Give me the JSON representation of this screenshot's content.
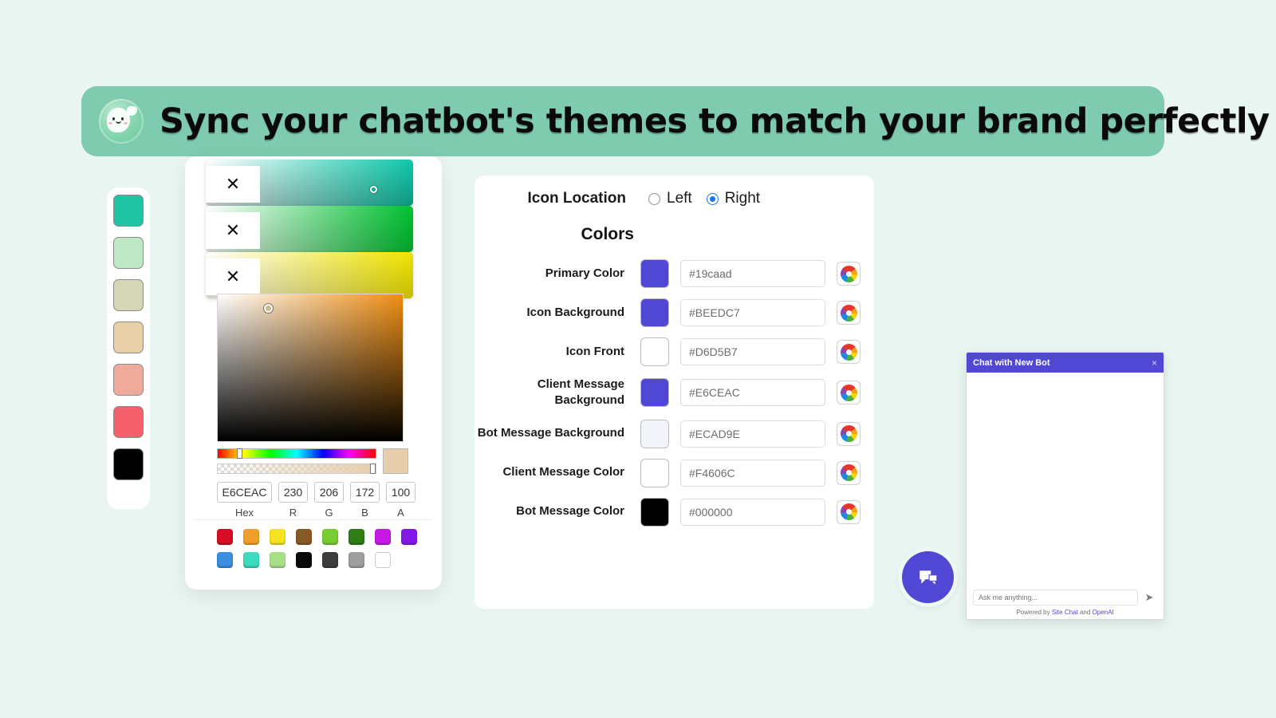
{
  "banner": {
    "title": "Sync your chatbot's themes to match your brand perfectly",
    "background": "#7ecbb0",
    "logo_icon": "chat-mascot-icon"
  },
  "page": {
    "background": "#e8f5f0"
  },
  "swatch_rail": {
    "swatches": [
      {
        "name": "teal",
        "color": "#1fc4a4"
      },
      {
        "name": "light-mint",
        "color": "#bfe9c6"
      },
      {
        "name": "sage-beige",
        "color": "#d5d6b6"
      },
      {
        "name": "tan",
        "color": "#e9cfa8"
      },
      {
        "name": "salmon",
        "color": "#eeab9b"
      },
      {
        "name": "coral-red",
        "color": "#f4606c"
      },
      {
        "name": "black",
        "color": "#000000"
      }
    ]
  },
  "color_picker": {
    "close_label": "✕",
    "mini_pickers": [
      {
        "name": "teal-gradient",
        "from": "#ffffff",
        "to": "#0fc8aa"
      },
      {
        "name": "green-gradient",
        "from": "#ffffff",
        "to": "#00c230"
      },
      {
        "name": "yellow-gradient",
        "from": "#ffffff",
        "to": "#f0e400"
      }
    ],
    "saturation": {
      "hue_color": "#ef8e12"
    },
    "preview": "#e6ceac",
    "fields": [
      {
        "label": "Hex",
        "value": "E6CEAC",
        "kind": "hex"
      },
      {
        "label": "R",
        "value": "230",
        "kind": "num"
      },
      {
        "label": "G",
        "value": "206",
        "kind": "num"
      },
      {
        "label": "B",
        "value": "172",
        "kind": "num"
      },
      {
        "label": "A",
        "value": "100",
        "kind": "num"
      }
    ],
    "palette": [
      "#d80d23",
      "#f0a02a",
      "#f5e320",
      "#8a5a26",
      "#78cc32",
      "#2e7d15",
      "#c619e6",
      "#8318e8",
      "#3b8ee0",
      "#3cdcc0",
      "#a8e08a",
      "#0a0a0a",
      "#3d3d3d",
      "#9e9e9e",
      "#ffffff"
    ]
  },
  "settings": {
    "icon_location": {
      "label": "Icon Location",
      "options": [
        {
          "label": "Left",
          "selected": false
        },
        {
          "label": "Right",
          "selected": true
        }
      ]
    },
    "colors_heading": "Colors",
    "accent": "#5147d5",
    "rows": [
      {
        "label": "Primary Color",
        "value": "#19caad",
        "chip": "#5147d5"
      },
      {
        "label": "Icon Background",
        "value": "#BEEDC7",
        "chip": "#5147d5"
      },
      {
        "label": "Icon Front",
        "value": "#D6D5B7",
        "chip": "#ffffff"
      },
      {
        "label": "Client Message Background",
        "value": "#E6CEAC",
        "chip": "#5147d5"
      },
      {
        "label": "Bot Message Background",
        "value": "#ECAD9E",
        "chip": "#f1f4f9"
      },
      {
        "label": "Client Message Color",
        "value": "#F4606C",
        "chip": "#ffffff"
      },
      {
        "label": "Bot Message Color",
        "value": "#000000",
        "chip": "#000000"
      }
    ]
  },
  "chat_widget": {
    "title": "Chat with New Bot",
    "close_label": "×",
    "input_placeholder": "Ask me anything...",
    "send_icon": "send-icon",
    "footer": {
      "prefix": "Powered by ",
      "link1": "Site Chat",
      "middle": " and ",
      "link2": "OpenAI"
    },
    "fab_icon": "chat-bubble-icon",
    "header_color": "#5147d5"
  }
}
